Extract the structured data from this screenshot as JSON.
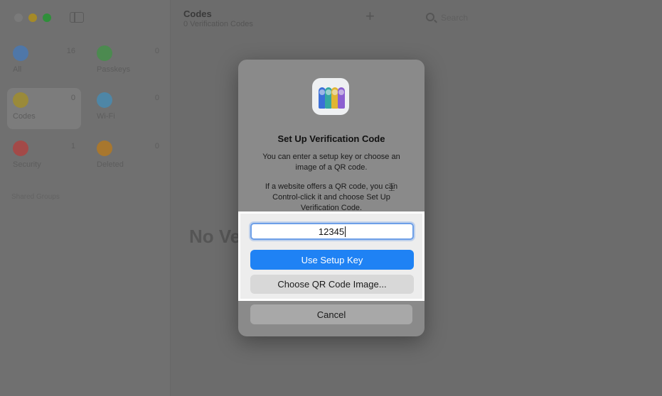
{
  "window": {
    "title": "Codes",
    "subtitle": "0 Verification Codes",
    "search_placeholder": "Search",
    "add_label": "+",
    "empty_state": "No Ve"
  },
  "sidebar": {
    "tiles": [
      {
        "label": "All",
        "count": "16",
        "color": "#4f77a8"
      },
      {
        "label": "Passkeys",
        "count": "0",
        "color": "#4c8a50"
      },
      {
        "label": "Codes",
        "count": "0",
        "color": "#9a8a3a"
      },
      {
        "label": "Wi-Fi",
        "count": "0",
        "color": "#4e86a6"
      },
      {
        "label": "Security",
        "count": "1",
        "color": "#a34a48"
      },
      {
        "label": "Deleted",
        "count": "0",
        "color": "#a8772e"
      }
    ],
    "section_label": "Shared Groups"
  },
  "dialog": {
    "title": "Set Up Verification Code",
    "line1": "You can enter a setup key or choose an image of a QR code.",
    "line2": "If a website offers a QR code, you can Control-click it and choose Set Up Verification Code.",
    "key_value": "12345",
    "use_key_label": "Use Setup Key",
    "choose_qr_label": "Choose QR Code Image...",
    "cancel_label": "Cancel",
    "key_colors": [
      "#3b6fd8",
      "#35a8a0",
      "#e0b533",
      "#8c5fd1"
    ]
  }
}
